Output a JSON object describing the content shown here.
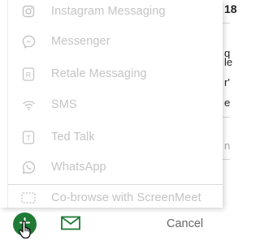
{
  "menu": {
    "items": [
      {
        "label": "Instagram Messaging",
        "icon": "instagram-icon"
      },
      {
        "label": "Messenger",
        "icon": "messenger-icon"
      },
      {
        "label": "Retale Messaging",
        "icon": "retale-icon"
      },
      {
        "label": "SMS",
        "icon": "sms-icon"
      },
      {
        "label": "Ted Talk",
        "icon": "ted-talk-icon"
      },
      {
        "label": "WhatsApp",
        "icon": "whatsapp-icon"
      },
      {
        "label": "Co-browse with ScreenMeet",
        "icon": "screenmeet-icon"
      }
    ]
  },
  "footer": {
    "cancel_label": "Cancel",
    "add_icon": "plus-icon",
    "mail_icon": "mail-icon"
  },
  "background": {
    "fragments": [
      "18",
      "q",
      "le",
      "r'",
      "e",
      "n"
    ]
  },
  "colors": {
    "menu_text": "#c4c4c4",
    "accent_green": "#1f7a35",
    "cancel_text": "#666666"
  }
}
